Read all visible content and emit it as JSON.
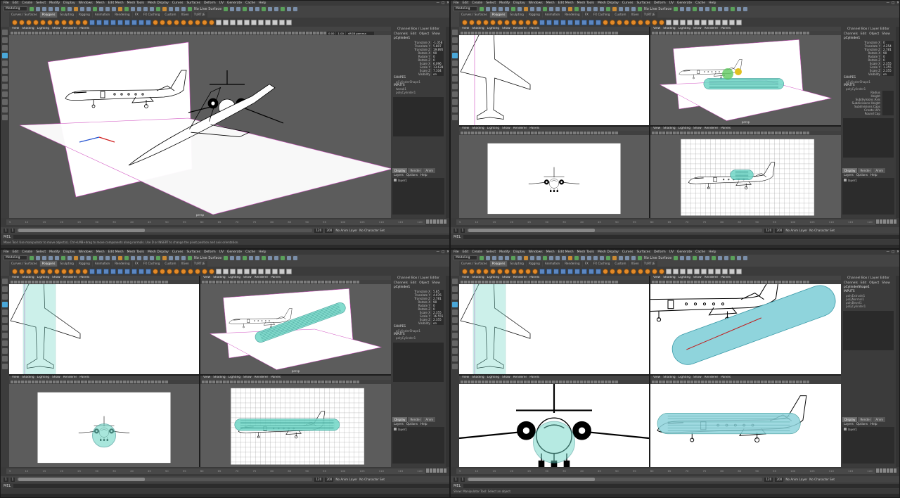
{
  "menus": [
    "File",
    "Edit",
    "Create",
    "Select",
    "Modify",
    "Display",
    "Windows",
    "Mesh",
    "Edit Mesh",
    "Mesh Tools",
    "Mesh Display",
    "Curves",
    "Surfaces",
    "Deform",
    "UV",
    "Generate",
    "Cache",
    "Help"
  ],
  "window_controls": [
    "—",
    "□",
    "✕"
  ],
  "mode": "Modeling",
  "live_surface": "No Live Surface",
  "shelf_tabs": [
    "Curves / Surfaces",
    "Polygons",
    "Sculpting",
    "Rigging",
    "Animation",
    "Rendering",
    "FX",
    "FX Caching",
    "Custom",
    "XGen",
    "TURTLE"
  ],
  "active_shelf_tab": "Polygons",
  "panel_menu": [
    "View",
    "Shading",
    "Lighting",
    "Show",
    "Renderer",
    "Panels"
  ],
  "camera": "persp",
  "color_space": "sRGB gamma",
  "gamma_a": "0.00",
  "gamma_b": "1.00",
  "channel_box_title": "Channel Box / Layer Editor",
  "channel_menu": [
    "Channels",
    "Edit",
    "Object",
    "Show"
  ],
  "attributes": [
    "Translate X",
    "Translate Y",
    "Translate Z",
    "Rotate X",
    "Rotate Y",
    "Rotate Z",
    "Scale X",
    "Scale Y",
    "Scale Z",
    "Visibility"
  ],
  "shapes_label": "SHAPES",
  "inputs_label": "INPUTS",
  "quads": [
    {
      "object": "pCylinder1",
      "values": [
        "-1.058",
        "5.807",
        "19.895",
        "90",
        "0",
        "0",
        "6.096",
        "13.639",
        "7.104",
        "on"
      ],
      "shape": "pCylinderShape1",
      "inputs": [
        "tweak1",
        "polyCylinder1"
      ]
    },
    {
      "object": "pCylinder1",
      "values": [
        "0",
        "4.254",
        "2.781",
        "90",
        "0",
        "0",
        "2.355",
        "1.355",
        "2.355",
        "on"
      ],
      "shape": "pCylinderShape1",
      "inputs": [
        "polyCylinder1"
      ],
      "extra": [
        "Radius",
        "Height",
        "Subdivisions Axis",
        "Subdivisions Height",
        "Subdivisions Caps",
        "Create UVs",
        "Round Cap"
      ]
    },
    {
      "object": "pCylinder1",
      "values": [
        "5.85",
        "4.076",
        "2.781",
        "90",
        "0",
        "0",
        "2.355",
        "16.555",
        "2.355",
        "on"
      ],
      "shape": "pCylinderShape1",
      "inputs": [
        "polyCylinder1"
      ]
    },
    {
      "object": "pCylinderShape1",
      "values": [],
      "shape": "",
      "inputs": [
        "polyExtrude1",
        "polyNormal1",
        "polyBevel1",
        "polyCylinder1"
      ]
    }
  ],
  "layer_tabs": [
    "Display",
    "Render",
    "Anim"
  ],
  "layer_menu": [
    "Layers",
    "Options",
    "Help"
  ],
  "layer_name": "layer1",
  "range_start": "1",
  "range_end": "120",
  "range_end_max": "200",
  "current_frame": "1",
  "anim_layer": "No Anim Layer",
  "char_set": "No Character Set",
  "mel_label": "MEL",
  "tick_labels": [
    "5",
    "10",
    "15",
    "20",
    "25",
    "30",
    "35",
    "40",
    "45",
    "50",
    "55",
    "60",
    "65",
    "70",
    "75",
    "80",
    "85",
    "90",
    "95",
    "100",
    "105",
    "110",
    "115",
    "120"
  ],
  "help_lines": [
    "Move Tool: Use manipulator to move object(s). Ctrl+LMB+drag to move components along normals. Use D or INSERT to change the pivot position and axis orientation.",
    "",
    "",
    "Show: Manipulator Tool: Select an object."
  ]
}
